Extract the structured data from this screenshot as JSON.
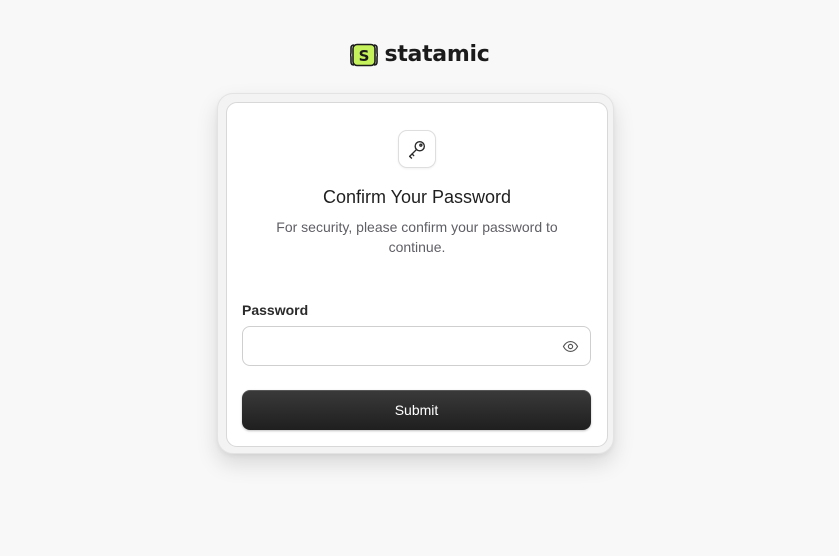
{
  "brand": {
    "logo_letter": "S",
    "name": "statamic",
    "logo_color": "#c5f15c"
  },
  "dialog": {
    "icon": "key-icon",
    "title": "Confirm Your Password",
    "subtitle_line1": "For security, please confirm your password to",
    "subtitle_line2": "continue."
  },
  "form": {
    "password_label": "Password",
    "password_value": "",
    "password_placeholder": "",
    "toggle_icon": "eye-icon",
    "submit_label": "Submit"
  }
}
